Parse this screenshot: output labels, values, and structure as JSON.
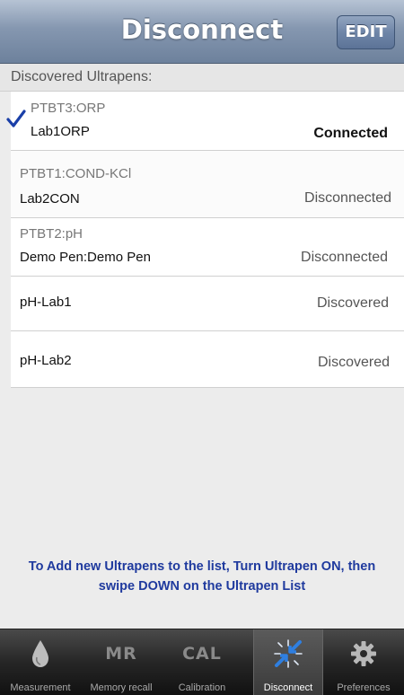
{
  "nav": {
    "title": "Disconnect",
    "edit_label": "EDIT"
  },
  "section_header": "Discovered Ultrapens:",
  "devices": [
    {
      "sub": "PTBT3:ORP",
      "name": "Lab1ORP",
      "status": "Connected",
      "selected": true
    },
    {
      "sub": "PTBT1:COND-KCl",
      "name": "Lab2CON",
      "status": "Disconnected",
      "selected": false
    },
    {
      "sub": "PTBT2:pH",
      "name": "Demo Pen:Demo Pen",
      "status": "Disconnected",
      "selected": false
    },
    {
      "sub": "",
      "name": "pH-Lab1",
      "status": "Discovered",
      "selected": false
    },
    {
      "sub": "",
      "name": "pH-Lab2",
      "status": "Discovered",
      "selected": false
    }
  ],
  "hint": {
    "line1": "To Add new Ultrapens to the list, Turn Ultrapen ON, then",
    "line2": "swipe DOWN on the Ultrapen List"
  },
  "tabs": [
    {
      "label": "Measurement",
      "icon": "drop-icon"
    },
    {
      "label": "Memory recall",
      "icon_text": "MR"
    },
    {
      "label": "Calibration",
      "icon_text": "CAL"
    },
    {
      "label": "Disconnect",
      "icon": "disconnect-icon",
      "active": true
    },
    {
      "label": "Preferences",
      "icon": "gear-icon"
    }
  ],
  "colors": {
    "accent": "#1f3a9e",
    "nav": "#7d90ab",
    "checkmark": "#1a3fa8",
    "active_tab_icon": "#2f7fe0"
  }
}
